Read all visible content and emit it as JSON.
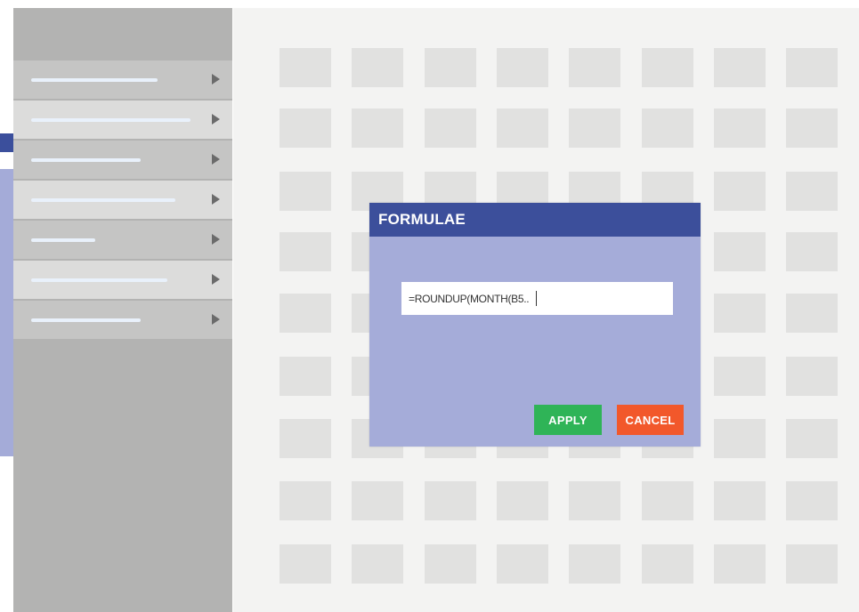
{
  "dialog": {
    "title": "FORMULAE",
    "formula_value": "=ROUNDUP(MONTH(B5..",
    "apply_label": "APPLY",
    "cancel_label": "CANCEL"
  },
  "sidebar": {
    "items": [
      {
        "name": "menu-item-1",
        "active": false
      },
      {
        "name": "menu-item-2",
        "active": true
      },
      {
        "name": "menu-item-3",
        "active": false
      },
      {
        "name": "menu-item-4",
        "active": true
      },
      {
        "name": "menu-item-5",
        "active": false
      },
      {
        "name": "menu-item-6",
        "active": true
      },
      {
        "name": "menu-item-7",
        "active": false
      }
    ]
  },
  "colors": {
    "dialog_header": "#3c4f9b",
    "dialog_body": "#a5acd9",
    "apply": "#2fb457",
    "cancel": "#f2582b",
    "sidebar": "#b3b3b2"
  },
  "icons": {
    "menu_arrow": "play-arrow-icon"
  }
}
